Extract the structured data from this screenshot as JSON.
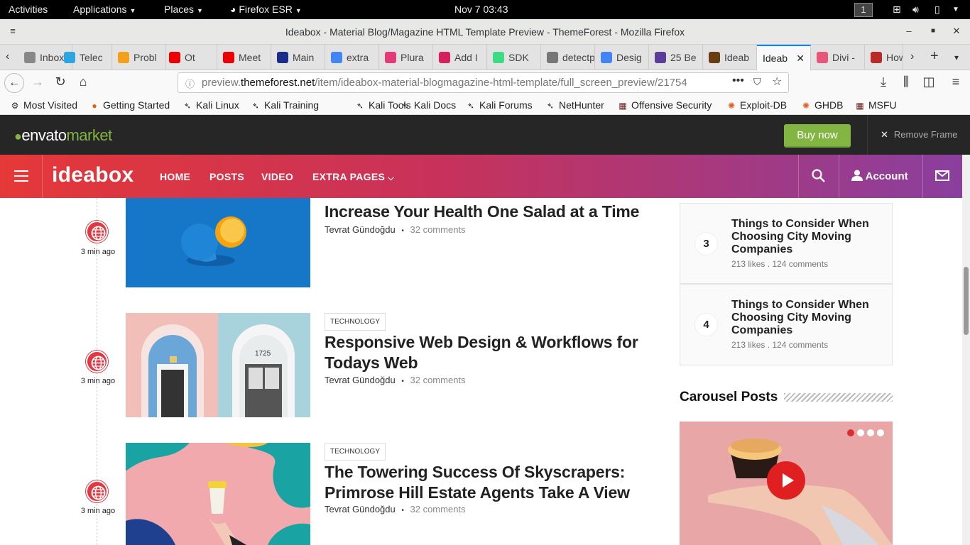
{
  "gnome": {
    "activities": "Activities",
    "applications": "Applications",
    "places": "Places",
    "app": "Firefox ESR",
    "clock": "Nov 7  03:43",
    "workspace": "1"
  },
  "window": {
    "title": "Ideabox - Material Blog/Magazine HTML Template Preview - ThemeForest - Mozilla Firefox"
  },
  "tabs": [
    {
      "label": "Inbox",
      "color": "#888"
    },
    {
      "label": "Telec",
      "color": "#2ca5e0"
    },
    {
      "label": "Probl",
      "color": "#f4a11a"
    },
    {
      "label": "Ot",
      "color": "#e00"
    },
    {
      "label": "Meet",
      "color": "#e00"
    },
    {
      "label": "Main",
      "color": "#1b2c8a"
    },
    {
      "label": "extra",
      "color": "#4285f4"
    },
    {
      "label": "Plura",
      "color": "#e33b78"
    },
    {
      "label": "Add I",
      "color": "#d72060"
    },
    {
      "label": "SDK",
      "color": "#3ddc84"
    },
    {
      "label": "detectpo",
      "color": "#777"
    },
    {
      "label": "Desig",
      "color": "#4285f4"
    },
    {
      "label": "25 Be",
      "color": "#5b3d9a"
    },
    {
      "label": "Ideab",
      "color": "#6b3b12"
    },
    {
      "label": "Ideab",
      "color": "#fff"
    },
    {
      "label": "Divi -",
      "color": "#e8577a"
    },
    {
      "label": "How",
      "color": "#b92b27"
    }
  ],
  "url": {
    "prefix": "preview.",
    "host": "themeforest.net",
    "path": "/item/ideabox-material-blogmagazine-html-template/full_screen_preview/21754"
  },
  "bookmarks": [
    "Most Visited",
    "Getting Started",
    "Kali Linux",
    "Kali Training",
    "Kali Tools",
    "Kali Docs",
    "Kali Forums",
    "NetHunter",
    "Offensive Security",
    "Exploit-DB",
    "GHDB",
    "MSFU"
  ],
  "envato": {
    "logo_a": "envato",
    "logo_b": "market",
    "buy": "Buy now",
    "remove": "Remove Frame"
  },
  "site": {
    "brand": "ideabox",
    "menu": [
      "HOME",
      "POSTS",
      "VIDEO",
      "EXTRA PAGES"
    ],
    "account": "Account"
  },
  "posts": [
    {
      "category": "",
      "title_lines": [
        "Increase Your Health One Salad at a Time"
      ],
      "author": "Tevrat Gündoğdu",
      "comments": "32 comments",
      "ago": "3 min ago"
    },
    {
      "category": "TECHNOLOGY",
      "title_lines": [
        "Responsive Web Design & Workflows for",
        "Todays Web"
      ],
      "author": "Tevrat Gündoğdu",
      "comments": "32 comments",
      "ago": "3 min ago"
    },
    {
      "category": "TECHNOLOGY",
      "title_lines": [
        "The Towering Success Of Skyscrapers:",
        "Primrose Hill Estate Agents Take A View"
      ],
      "author": "Tevrat Gündoğdu",
      "comments": "32 comments",
      "ago": "3 min ago"
    }
  ],
  "popular": [
    {
      "num": "3",
      "title_lines": [
        "Things to Consider When",
        "Choosing City Moving",
        "Companies"
      ],
      "meta": "213 likes . 124 comments"
    },
    {
      "num": "4",
      "title_lines": [
        "Things to Consider When",
        "Choosing City Moving",
        "Companies"
      ],
      "meta": "213 likes . 124 comments"
    }
  ],
  "carousel": {
    "heading": "Carousel Posts",
    "slide_count": 4,
    "active_slide": 1
  }
}
